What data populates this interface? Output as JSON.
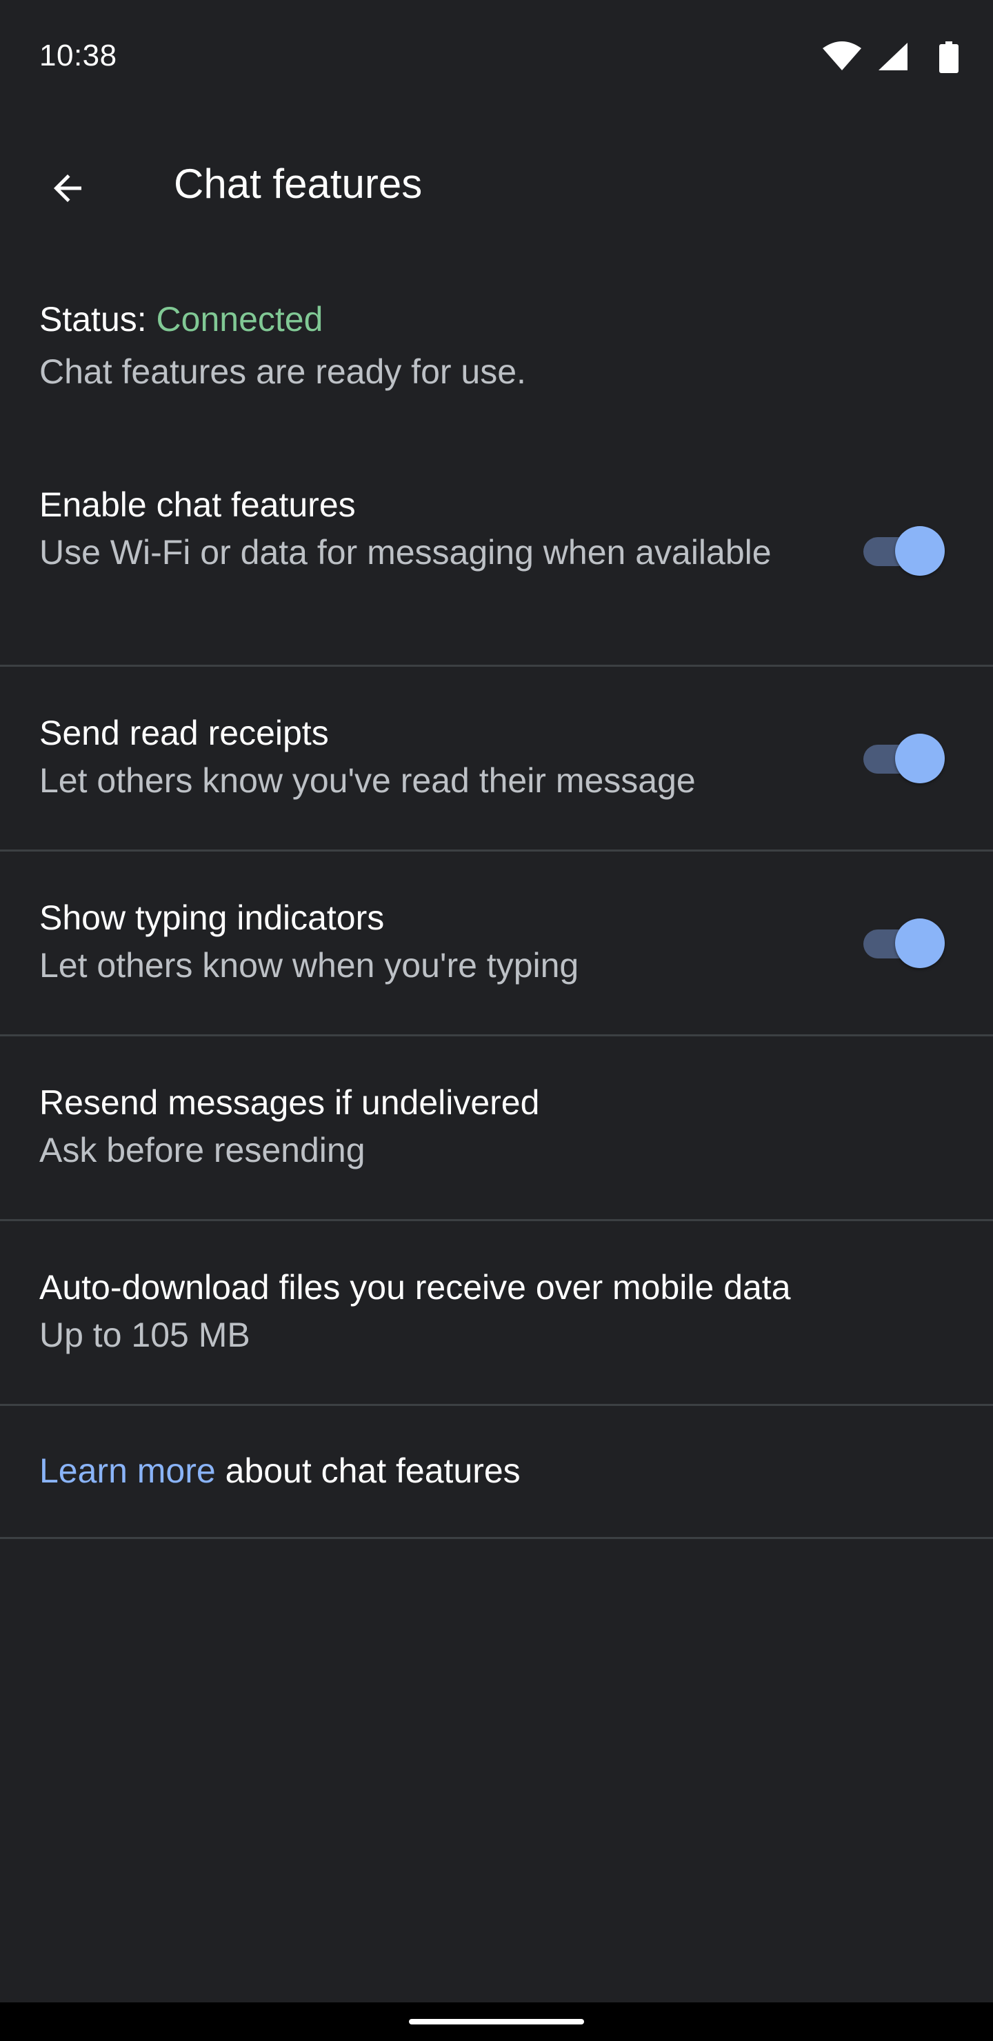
{
  "status_bar": {
    "time": "10:38",
    "icons": [
      "wifi-icon",
      "cell-signal-icon",
      "battery-icon"
    ]
  },
  "app_bar": {
    "back_icon": "arrow-back-icon",
    "title": "Chat features"
  },
  "status": {
    "label": "Status: ",
    "value": "Connected",
    "value_color": "#81c995",
    "description": "Chat features are ready for use."
  },
  "settings": [
    {
      "title": "Enable chat features",
      "subtitle": "Use Wi-Fi or data for messaging when available",
      "toggle_on": true
    },
    {
      "title": "Send read receipts",
      "subtitle": "Let others know you've read their message",
      "toggle_on": true
    },
    {
      "title": "Show typing indicators",
      "subtitle": "Let others know when you're typing",
      "toggle_on": true
    },
    {
      "title": "Resend messages if undelivered",
      "subtitle": "Ask before resending"
    },
    {
      "title": "Auto-download files you receive over mobile data",
      "subtitle": "Up to 105 MB"
    }
  ],
  "learn_more": {
    "link_text": "Learn more",
    "rest_text": " about chat features",
    "link_color": "#8ab4f8"
  },
  "colors": {
    "background": "#202124",
    "accent": "#8ab4f8",
    "divider": "#3c4043"
  }
}
